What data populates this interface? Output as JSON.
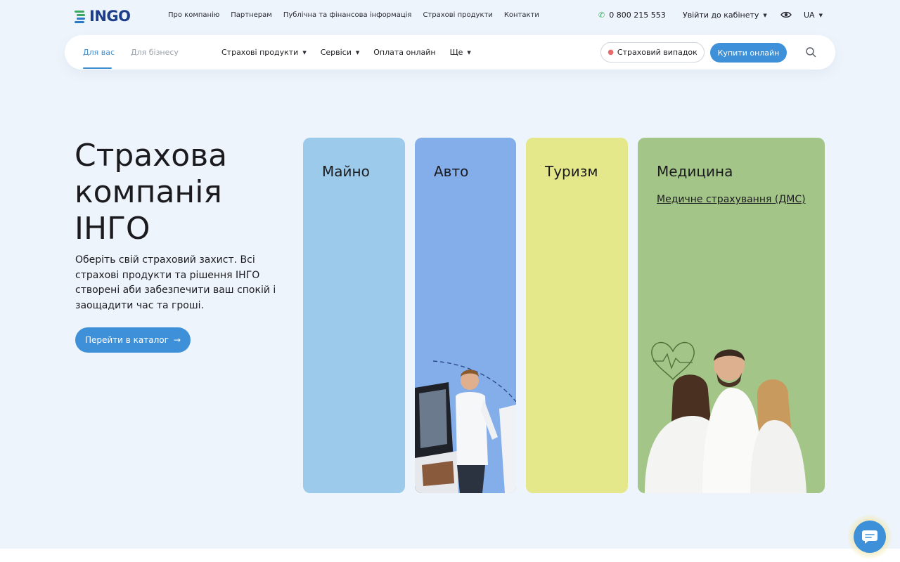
{
  "brand": {
    "name": "INGO",
    "colors": {
      "primary": "#3e91d8",
      "logo": "#1d3f8a"
    }
  },
  "topbar": {
    "links": [
      "Про компанію",
      "Партнерам",
      "Публічна та фінансова інформація",
      "Страхові продукти",
      "Контакти"
    ],
    "phone": "0 800 215 553",
    "cabinet": "Увійти до кабінету",
    "lang": "UA"
  },
  "nav": {
    "audience_tabs": [
      "Для вас",
      "Для бізнесу"
    ],
    "menu": [
      "Страхові продукти",
      "Сервіси",
      "Оплата онлайн",
      "Ще"
    ],
    "case_button": "Страховий випадок",
    "buy_button": "Купити онлайн"
  },
  "hero": {
    "title_lines": [
      "Страхова",
      "компанія",
      "ІНГО"
    ],
    "description": "Оберіть свій страховий захист. Всі страхові продукти та рішення ІНГО створені аби забезпечити ваш спокій і заощадити час та гроші.",
    "cta": "Перейти в каталог"
  },
  "products": [
    {
      "title": "Майно",
      "color": "#9ccaeb"
    },
    {
      "title": "Авто",
      "color": "#84aee9"
    },
    {
      "title": "Туризм",
      "color": "#e4e88a"
    },
    {
      "title": "Медицина",
      "color": "#a3c688",
      "link": "Медичне страхування (ДМС)"
    }
  ],
  "icons": [
    "phone-icon",
    "eye-icon",
    "search-icon",
    "pin-icon",
    "arrow-right-icon",
    "chat-icon",
    "caret-down-icon"
  ]
}
